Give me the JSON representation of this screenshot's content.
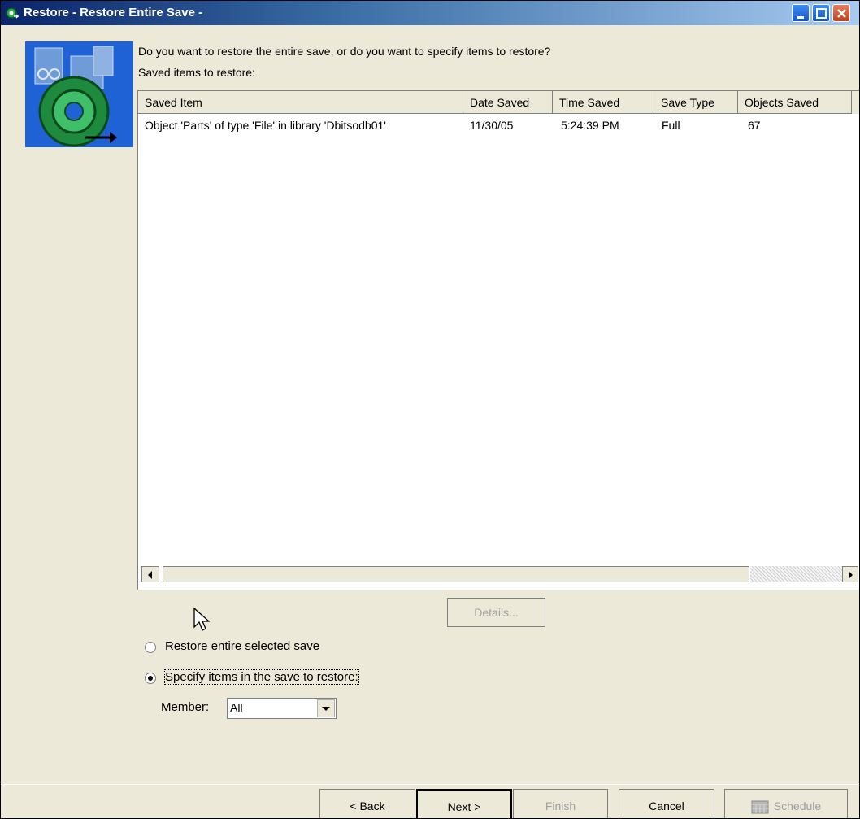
{
  "window": {
    "title": "Restore - Restore Entire Save -",
    "controls": [
      "minimize-icon",
      "maximize-icon",
      "close-icon"
    ]
  },
  "content": {
    "question": "Do you want to restore the entire save, or do you want to specify items to restore?",
    "saved_items_label": "Saved items to restore:"
  },
  "table": {
    "columns": [
      "Saved Item",
      "Date Saved",
      "Time Saved",
      "Save Type",
      "Objects Saved"
    ],
    "rows": [
      {
        "saved_item": "Object 'Parts' of type 'File' in library 'Dbitsodb01'",
        "date_saved": "11/30/05",
        "time_saved": "5:24:39 PM",
        "save_type": "Full",
        "objects_saved": "67"
      }
    ]
  },
  "buttons": {
    "details": "Details...",
    "back": "< Back",
    "next": "Next >",
    "finish": "Finish",
    "cancel": "Cancel",
    "schedule": "Schedule"
  },
  "options": {
    "restore_entire": "Restore entire selected save",
    "specify_items": "Specify items in the save to restore:",
    "selected": "specify_items"
  },
  "member": {
    "label": "Member:",
    "value": "All"
  }
}
